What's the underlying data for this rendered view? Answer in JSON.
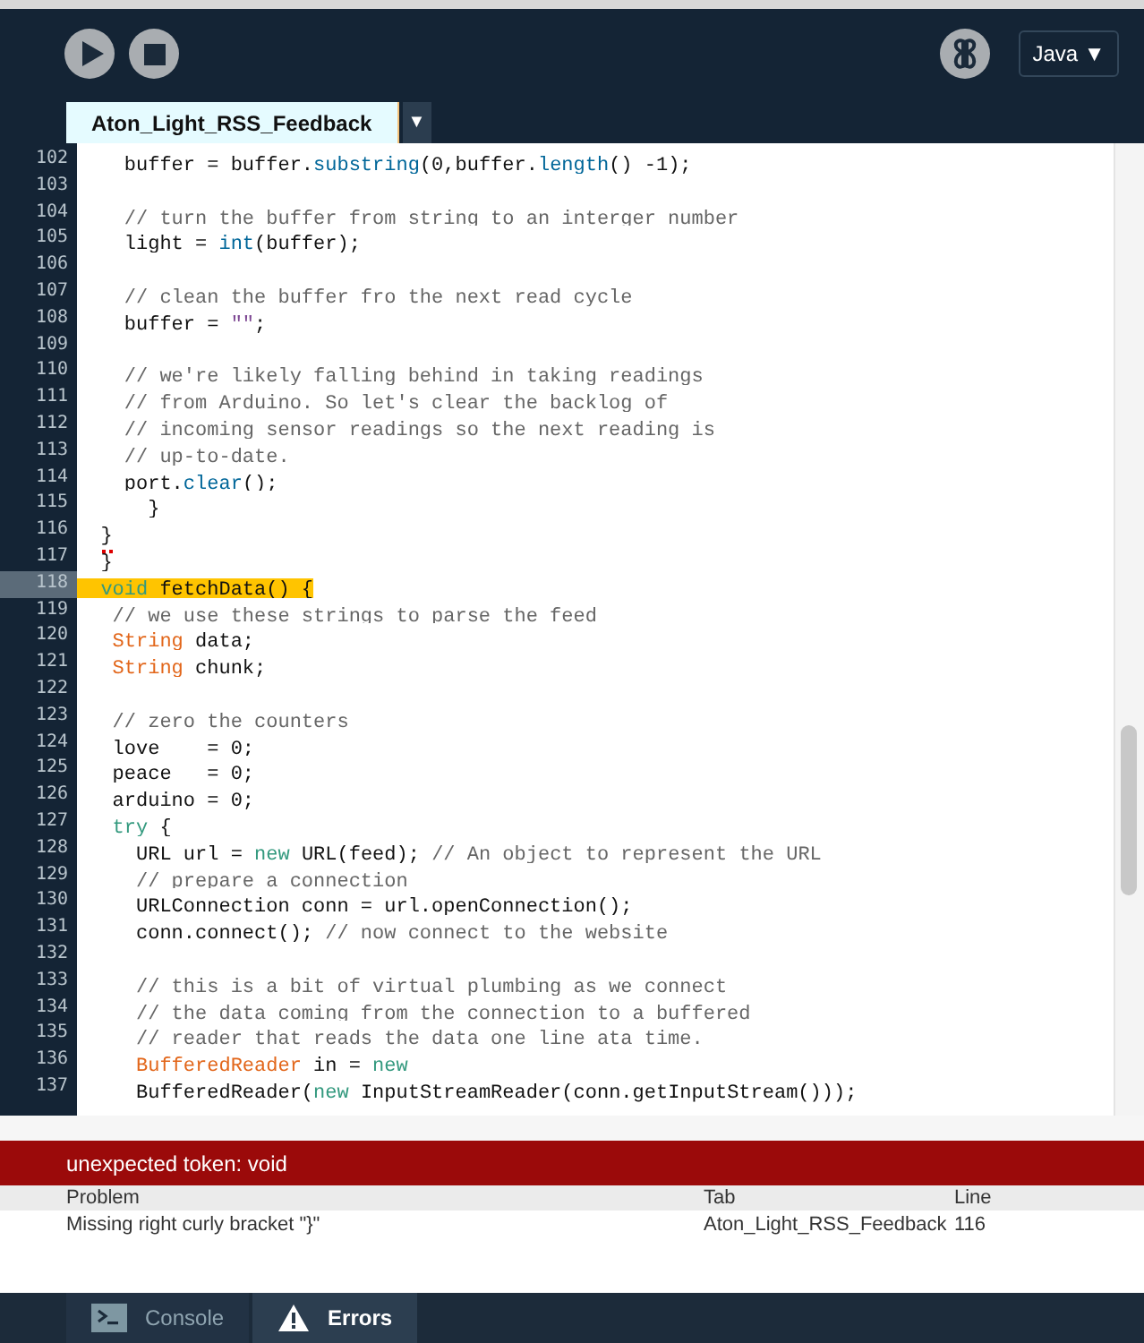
{
  "toolbar": {
    "run": {
      "kind": "run"
    },
    "stop": {
      "kind": "stop"
    },
    "debugger": {
      "kind": "debug"
    },
    "mode": {
      "label": "Java",
      "arrow": "▼"
    }
  },
  "tabs": [
    {
      "label": "Aton_Light_RSS_Feedback",
      "selected": true
    }
  ],
  "tab_menu": "▼",
  "editor": {
    "lines": [
      {
        "number": "102",
        "current": false,
        "tokens": [
          {
            "kind": "text",
            "text": "    buffer = buffer."
          },
          {
            "kind": "function",
            "text": "substring"
          },
          {
            "kind": "text",
            "text": "(0,buffer."
          },
          {
            "kind": "function",
            "text": "length"
          },
          {
            "kind": "text",
            "text": "() -1);"
          }
        ]
      },
      {
        "number": "103",
        "current": false
      },
      {
        "number": "104",
        "current": false,
        "tokens": [
          {
            "kind": "comment",
            "text": "    // turn the buffer from string to an interger number"
          }
        ]
      },
      {
        "number": "105",
        "current": false,
        "tokens": [
          {
            "kind": "text",
            "text": "    light = "
          },
          {
            "kind": "function",
            "text": "int"
          },
          {
            "kind": "text",
            "text": "(buffer);"
          }
        ]
      },
      {
        "number": "106",
        "current": false
      },
      {
        "number": "107",
        "current": false,
        "tokens": [
          {
            "kind": "comment",
            "text": "    // clean the buffer fro the next read cycle"
          }
        ]
      },
      {
        "number": "108",
        "current": false,
        "tokens": [
          {
            "kind": "text",
            "text": "    buffer = "
          },
          {
            "kind": "string",
            "text": "\"\""
          },
          {
            "kind": "text",
            "text": ";"
          }
        ]
      },
      {
        "number": "109",
        "current": false
      },
      {
        "number": "110",
        "current": false,
        "tokens": [
          {
            "kind": "comment",
            "text": "    // we're likely falling behind in taking readings"
          }
        ]
      },
      {
        "number": "111",
        "current": false,
        "tokens": [
          {
            "kind": "comment",
            "text": "    // from Arduino. So let's clear the backlog of"
          }
        ]
      },
      {
        "number": "112",
        "current": false,
        "tokens": [
          {
            "kind": "comment",
            "text": "    // incoming sensor readings so the next reading is"
          }
        ]
      },
      {
        "number": "113",
        "current": false,
        "tokens": [
          {
            "kind": "comment",
            "text": "    // up-to-date."
          }
        ]
      },
      {
        "number": "114",
        "current": false,
        "tokens": [
          {
            "kind": "text",
            "text": "    port."
          },
          {
            "kind": "function",
            "text": "clear"
          },
          {
            "kind": "text",
            "text": "();"
          }
        ]
      },
      {
        "number": "115",
        "current": false,
        "tokens": [
          {
            "kind": "text",
            "text": "      }"
          }
        ]
      },
      {
        "number": "116",
        "current": false,
        "tokens": [
          {
            "kind": "error",
            "text": "  }"
          }
        ]
      },
      {
        "number": "117",
        "current": false,
        "tokens": [
          {
            "kind": "text",
            "text": "  }"
          }
        ]
      },
      {
        "number": "118",
        "current": true,
        "tokens": [
          {
            "kind": "keyword",
            "text": "  void"
          },
          {
            "kind": "text",
            "text": " fetchData() {"
          }
        ]
      },
      {
        "number": "119",
        "current": false,
        "tokens": [
          {
            "kind": "comment",
            "text": "   // we use these strings to parse the feed"
          }
        ]
      },
      {
        "number": "120",
        "current": false,
        "tokens": [
          {
            "kind": "type",
            "text": "   String"
          },
          {
            "kind": "text",
            "text": " data;"
          }
        ]
      },
      {
        "number": "121",
        "current": false,
        "tokens": [
          {
            "kind": "type",
            "text": "   String"
          },
          {
            "kind": "text",
            "text": " chunk;"
          }
        ]
      },
      {
        "number": "122",
        "current": false
      },
      {
        "number": "123",
        "current": false,
        "tokens": [
          {
            "kind": "comment",
            "text": "   // zero the counters"
          }
        ]
      },
      {
        "number": "124",
        "current": false,
        "tokens": [
          {
            "kind": "text",
            "text": "   love    = 0;"
          }
        ]
      },
      {
        "number": "125",
        "current": false,
        "tokens": [
          {
            "kind": "text",
            "text": "   peace   = 0;"
          }
        ]
      },
      {
        "number": "126",
        "current": false,
        "tokens": [
          {
            "kind": "text",
            "text": "   arduino = 0;"
          }
        ]
      },
      {
        "number": "127",
        "current": false,
        "tokens": [
          {
            "kind": "keyword",
            "text": "   try"
          },
          {
            "kind": "text",
            "text": " {"
          }
        ]
      },
      {
        "number": "128",
        "current": false,
        "tokens": [
          {
            "kind": "text",
            "text": "     URL url = "
          },
          {
            "kind": "keyword",
            "text": "new"
          },
          {
            "kind": "text",
            "text": " URL(feed); "
          },
          {
            "kind": "comment",
            "text": "// An object to represent the URL"
          }
        ]
      },
      {
        "number": "129",
        "current": false,
        "tokens": [
          {
            "kind": "comment",
            "text": "     // prepare a connection"
          }
        ]
      },
      {
        "number": "130",
        "current": false,
        "tokens": [
          {
            "kind": "text",
            "text": "     URLConnection conn = url.openConnection();"
          }
        ]
      },
      {
        "number": "131",
        "current": false,
        "tokens": [
          {
            "kind": "text",
            "text": "     conn.connect(); "
          },
          {
            "kind": "comment",
            "text": "// now connect to the website"
          }
        ]
      },
      {
        "number": "132",
        "current": false
      },
      {
        "number": "133",
        "current": false,
        "tokens": [
          {
            "kind": "comment",
            "text": "     // this is a bit of virtual plumbing as we connect"
          }
        ]
      },
      {
        "number": "134",
        "current": false,
        "tokens": [
          {
            "kind": "comment",
            "text": "     // the data coming from the connection to a buffered"
          }
        ]
      },
      {
        "number": "135",
        "current": false,
        "tokens": [
          {
            "kind": "comment",
            "text": "     // reader that reads the data one line ata time."
          }
        ]
      },
      {
        "number": "136",
        "current": false,
        "tokens": [
          {
            "kind": "type",
            "text": "     BufferedReader"
          },
          {
            "kind": "text",
            "text": " in = "
          },
          {
            "kind": "keyword",
            "text": "new"
          }
        ]
      },
      {
        "number": "137",
        "current": false,
        "tokens": [
          {
            "kind": "text",
            "text": "     BufferedReader("
          },
          {
            "kind": "keyword",
            "text": "new"
          },
          {
            "kind": "text",
            "text": " InputStreamReader(conn.getInputStream()));"
          }
        ]
      }
    ]
  },
  "error_bar": {
    "message": "unexpected token: void"
  },
  "problems": {
    "columns": [
      "Problem",
      "Tab",
      "Line"
    ],
    "rows": [
      [
        "Missing right curly bracket \"}\"",
        "Aton_Light_RSS_Feedback",
        "116"
      ]
    ]
  },
  "bottom_tabs": [
    {
      "label": "Console",
      "kind": "console",
      "selected": false
    },
    {
      "label": "Errors",
      "kind": "errors",
      "selected": true
    }
  ]
}
